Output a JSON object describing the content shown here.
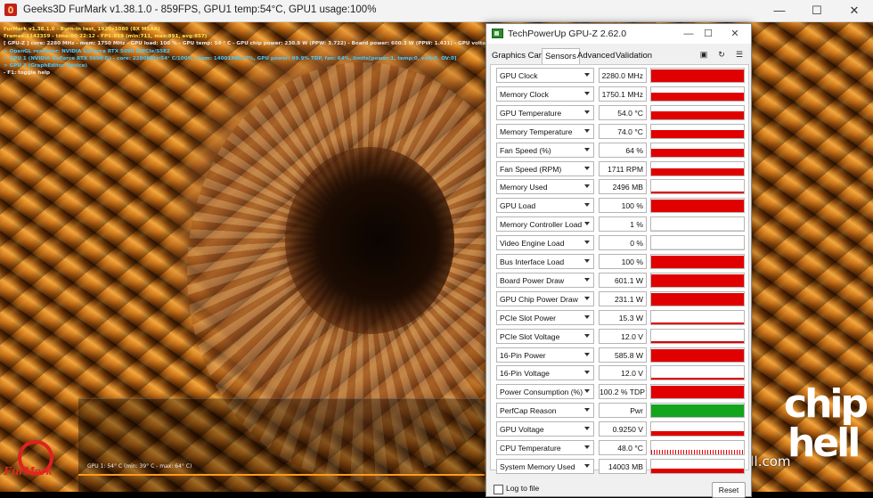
{
  "furmark": {
    "title": "Geeks3D FurMark v1.38.1.0 - 859FPS, GPU1 temp:54°C, GPU1 usage:100%",
    "overlay": [
      {
        "text": "FurMark v1.38.1.0 - Burn-in test, 1920x1080 (8X MSAA)",
        "color": "yellow"
      },
      {
        "text": "Frames:1142359 - time:00:22:12 - FPS:859 (min:711, max:891, avg:857)",
        "color": "yellow"
      },
      {
        "text": "[ GPU-Z ] core: 2280 MHz - mem: 1750 MHz - GPU load: 100 % - GPU temp: 54 ° C - GPU chip power: 230.8 W (PPW: 3.722) - Board power: 600.3 W (PPW: 1.431) - GPU voltage: 0.925 V",
        "color": "white"
      },
      {
        "text": "> OpenGL renderer: NVIDIA GeForce RTX 5090 D/PCIe/SSE2",
        "color": "cyan"
      },
      {
        "text": "> GPU 1 (NVIDIA GeForce RTX 5090 D) - core: 2280MHz:54° C/100%, mem: 14001MHz:7%, GPU power: 99.9% TDP, fan: 64%, limits[power:1, temp:0, volt:0, OV:0]",
        "color": "cyan"
      },
      {
        "text": "> GPU 2 (GraphEditor Device)",
        "color": "cyan"
      },
      {
        "text": "- F1: toggle help",
        "color": "white"
      }
    ],
    "graph_label": "GPU 1: 54° C (min: 39° C - max: 64° C)",
    "badge": "FurMark"
  },
  "watermark": {
    "site": "www.chiphell.com",
    "logo_line1": "chip",
    "logo_line2": "hell"
  },
  "gpuz": {
    "title": "TechPowerUp GPU-Z 2.62.0",
    "tabs": [
      "Graphics Card",
      "Sensors",
      "Advanced",
      "Validation"
    ],
    "active_tab": "Sensors",
    "sensors": [
      {
        "label": "GPU Clock",
        "value": "2280.0 MHz",
        "level": 0.95
      },
      {
        "label": "Memory Clock",
        "value": "1750.1 MHz",
        "level": 0.6
      },
      {
        "label": "GPU Temperature",
        "value": "54.0 °C",
        "level": 0.6
      },
      {
        "label": "Memory Temperature",
        "value": "74.0 °C",
        "level": 0.6
      },
      {
        "label": "Fan Speed (%)",
        "value": "64 %",
        "level": 0.6
      },
      {
        "label": "Fan Speed (RPM)",
        "value": "1711 RPM",
        "level": 0.5
      },
      {
        "label": "Memory Used",
        "value": "2496 MB",
        "level": 0.12
      },
      {
        "label": "GPU Load",
        "value": "100 %",
        "level": 0.95
      },
      {
        "label": "Memory Controller Load",
        "value": "1 %",
        "level": 0
      },
      {
        "label": "Video Engine Load",
        "value": "0 %",
        "level": 0
      },
      {
        "label": "Bus Interface Load",
        "value": "100 %",
        "level": 0.95
      },
      {
        "label": "Board Power Draw",
        "value": "601.1 W",
        "level": 0.95
      },
      {
        "label": "GPU Chip Power Draw",
        "value": "231.1 W",
        "level": 0.95
      },
      {
        "label": "PCIe Slot Power",
        "value": "15.3 W",
        "level": 0.15
      },
      {
        "label": "PCIe Slot Voltage",
        "value": "12.0 V",
        "level": 0.15
      },
      {
        "label": "16-Pin Power",
        "value": "585.8 W",
        "level": 0.95
      },
      {
        "label": "16-Pin Voltage",
        "value": "12.0 V",
        "level": 0.15
      },
      {
        "label": "Power Consumption (%)",
        "value": "100.2 % TDP",
        "level": 0.95
      },
      {
        "label": "PerfCap Reason",
        "value": "Pwr",
        "level": 0.95,
        "color": "#13a51c"
      },
      {
        "label": "GPU Voltage",
        "value": "0.9250 V",
        "level": 0.3
      },
      {
        "label": "CPU Temperature",
        "value": "48.0 °C",
        "level": 0.3,
        "noisy": true
      },
      {
        "label": "System Memory Used",
        "value": "14003 MB",
        "level": 0.3
      }
    ],
    "log_label": "Log to file",
    "reset_label": "Reset",
    "bar_color": "#e00000"
  }
}
